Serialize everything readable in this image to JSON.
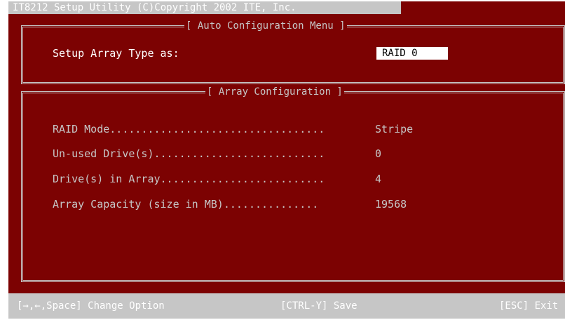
{
  "header": {
    "title": "IT8212 Setup Utility (C)Copyright 2002 ITE, Inc."
  },
  "auto_config": {
    "title": "[ Auto Configuration Menu ]",
    "label": "Setup Array Type as:",
    "value": "RAID 0"
  },
  "array_config": {
    "title": "[ Array Configuration ]",
    "rows": [
      {
        "label": "RAID Mode..................................",
        "value": "Stripe"
      },
      {
        "label": "Un-used Drive(s)...........................",
        "value": "0"
      },
      {
        "label": "Drive(s) in Array..........................",
        "value": "4"
      },
      {
        "label": "Array Capacity (size in MB)...............",
        "value": "19568"
      }
    ]
  },
  "footer": {
    "change_option": "[→,←,Space] Change Option",
    "save": "[CTRL-Y] Save",
    "exit": "[ESC] Exit"
  },
  "colors": {
    "background": "#7c0202",
    "frame": "#c6c6c6",
    "text": "#ffffff"
  }
}
